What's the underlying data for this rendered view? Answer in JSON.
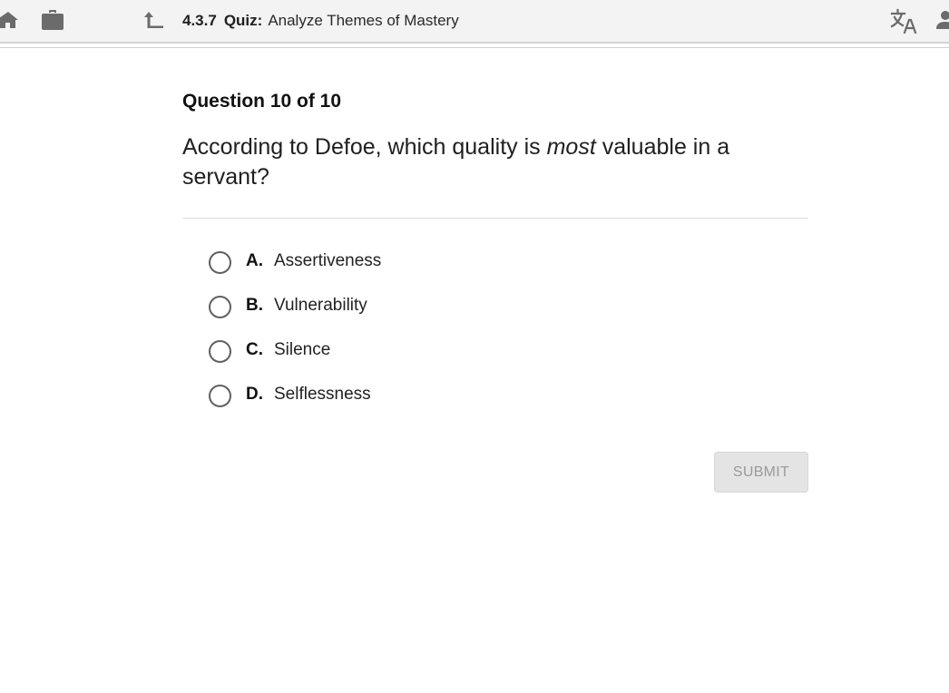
{
  "header": {
    "lesson_number": "4.3.7",
    "quiz_label": "Quiz:",
    "lesson_title": "Analyze Themes of Mastery",
    "icons": [
      "home-icon",
      "briefcase-icon",
      "upload-icon",
      "translate-icon",
      "person-icon"
    ]
  },
  "question": {
    "counter": "Question 10 of 10",
    "text_before": "According to Defoe, which quality is ",
    "text_emphasis": "most",
    "text_after": " valuable in a servant?"
  },
  "options": [
    {
      "letter": "A.",
      "text": "Assertiveness"
    },
    {
      "letter": "B.",
      "text": "Vulnerability"
    },
    {
      "letter": "C.",
      "text": "Silence"
    },
    {
      "letter": "D.",
      "text": "Selflessness"
    }
  ],
  "actions": {
    "submit_label": "SUBMIT"
  },
  "colors": {
    "topbar_bg": "#f3f3f3",
    "icon_gray": "#6b6b6b",
    "submit_disabled_bg": "#e4e4e4",
    "submit_disabled_text": "#9a9a9a"
  }
}
